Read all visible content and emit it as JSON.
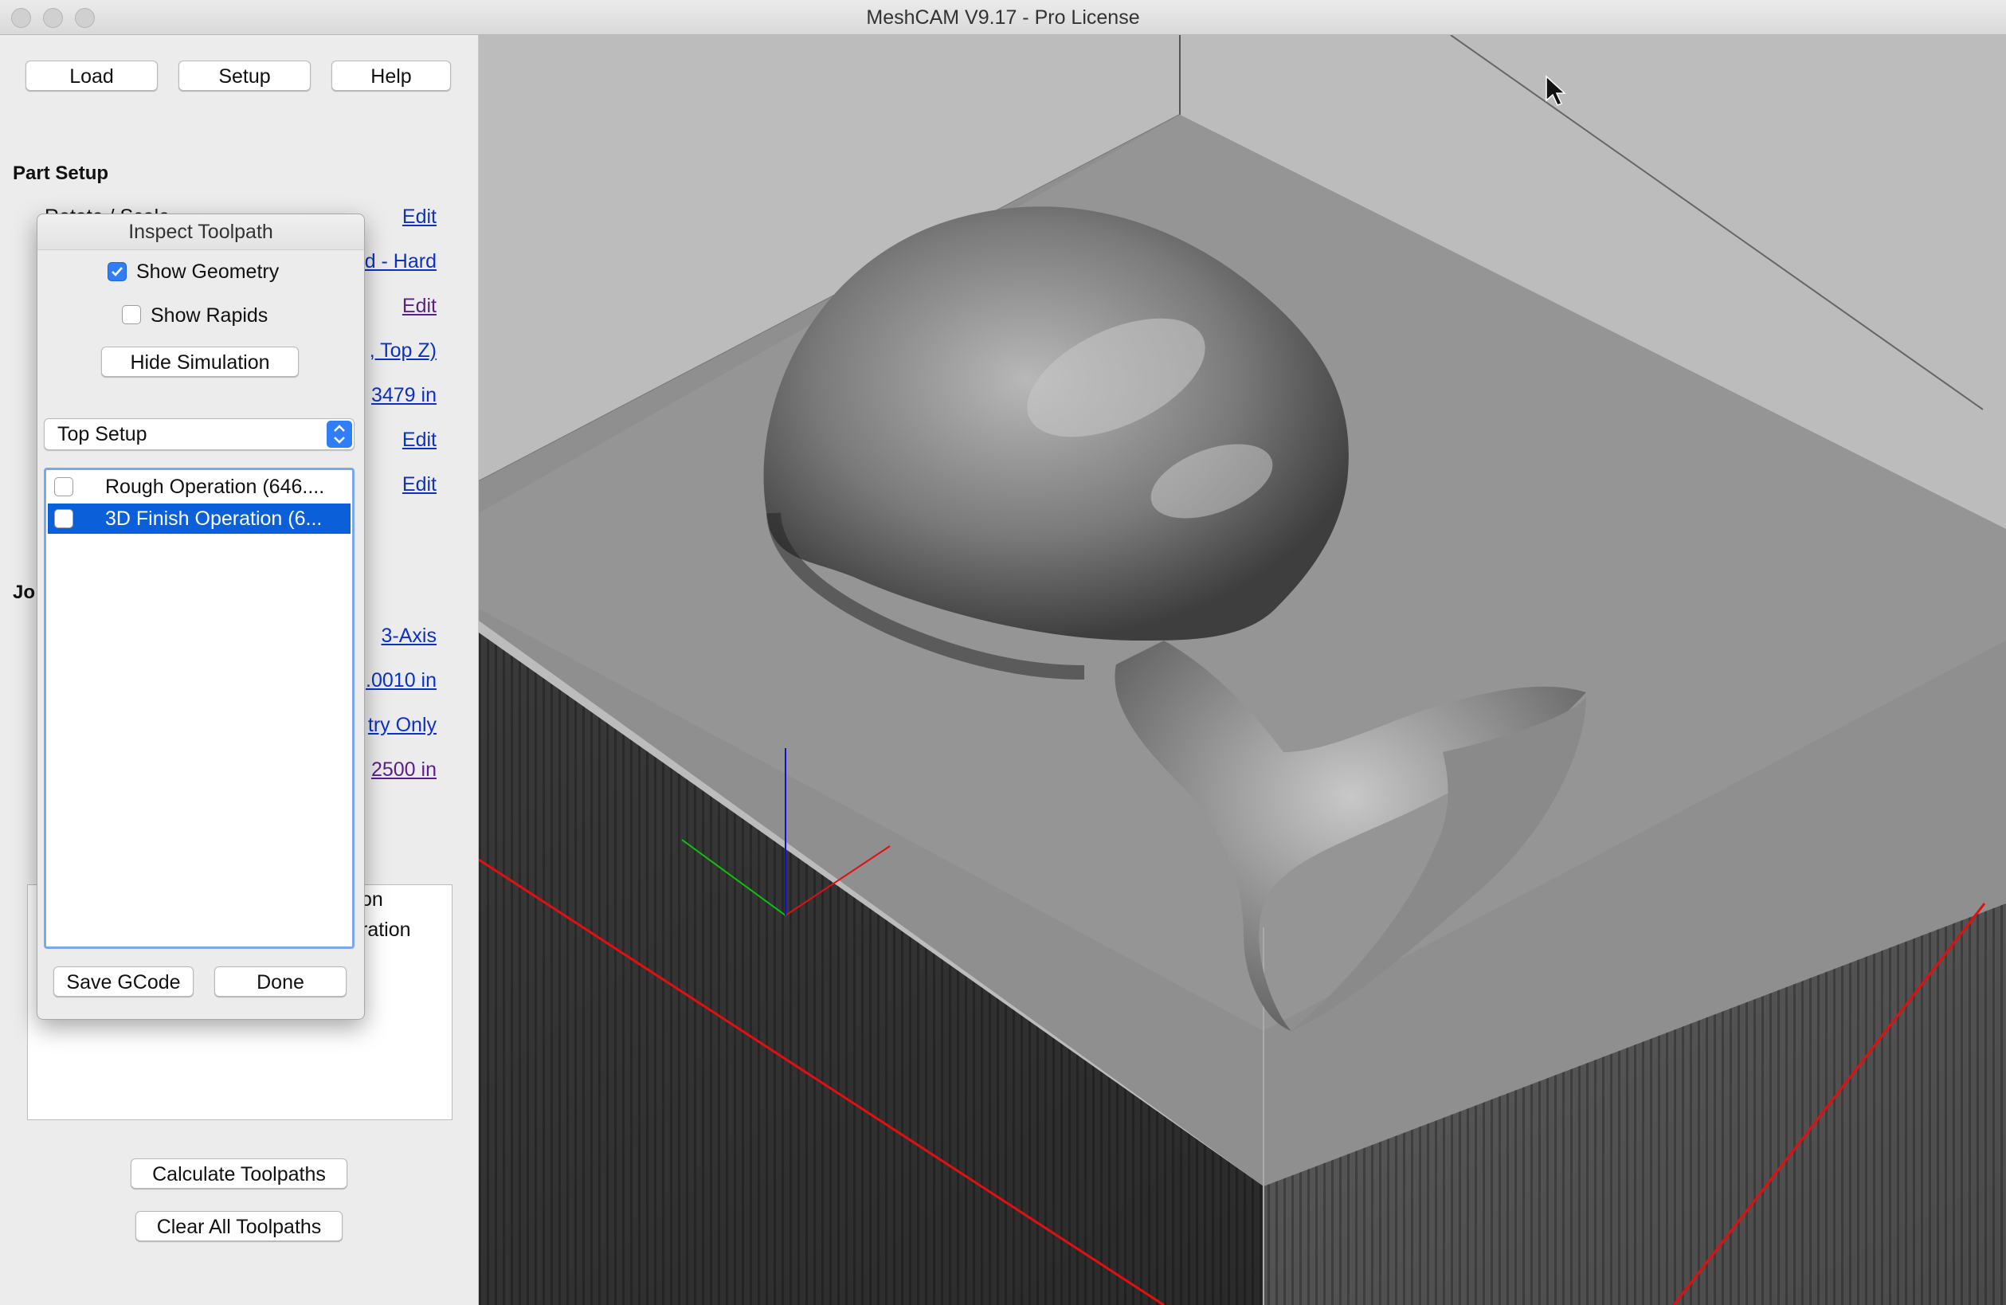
{
  "window": {
    "title": "MeshCAM V9.17 - Pro License"
  },
  "toolbar": {
    "load": "Load",
    "setup": "Setup",
    "help": "Help"
  },
  "part_setup": {
    "heading": "Part Setup",
    "hidden_label": "Rotate / Scale",
    "links": [
      "Edit",
      "d - Hard",
      "Edit",
      ", Top Z)",
      "3479 in",
      "Edit",
      "Edit"
    ]
  },
  "job": {
    "heading": "Jo",
    "links": [
      "3-Axis",
      ".0010 in",
      "try Only",
      "2500 in"
    ]
  },
  "operations_list": {
    "partial_items": [
      "on",
      "ration"
    ]
  },
  "bottom": {
    "calculate": "Calculate Toolpaths",
    "clear": "Clear All Toolpaths"
  },
  "dialog": {
    "title": "Inspect Toolpath",
    "show_geometry": {
      "label": "Show Geometry",
      "checked": true
    },
    "show_rapids": {
      "label": "Show Rapids",
      "checked": false
    },
    "hide_simulation": "Hide Simulation",
    "setup_select": {
      "value": "Top Setup"
    },
    "operations": [
      {
        "label": "Rough Operation (646....",
        "selected": false
      },
      {
        "label": "3D Finish Operation (6...",
        "selected": true
      }
    ],
    "save_gcode": "Save GCode",
    "done": "Done"
  },
  "colors": {
    "accent": "#2f7ef7",
    "selection": "#0b5fd9",
    "link": "#0b31c8",
    "axis_x": "#e01010",
    "axis_y": "#10c010",
    "axis_z": "#1010d0"
  }
}
